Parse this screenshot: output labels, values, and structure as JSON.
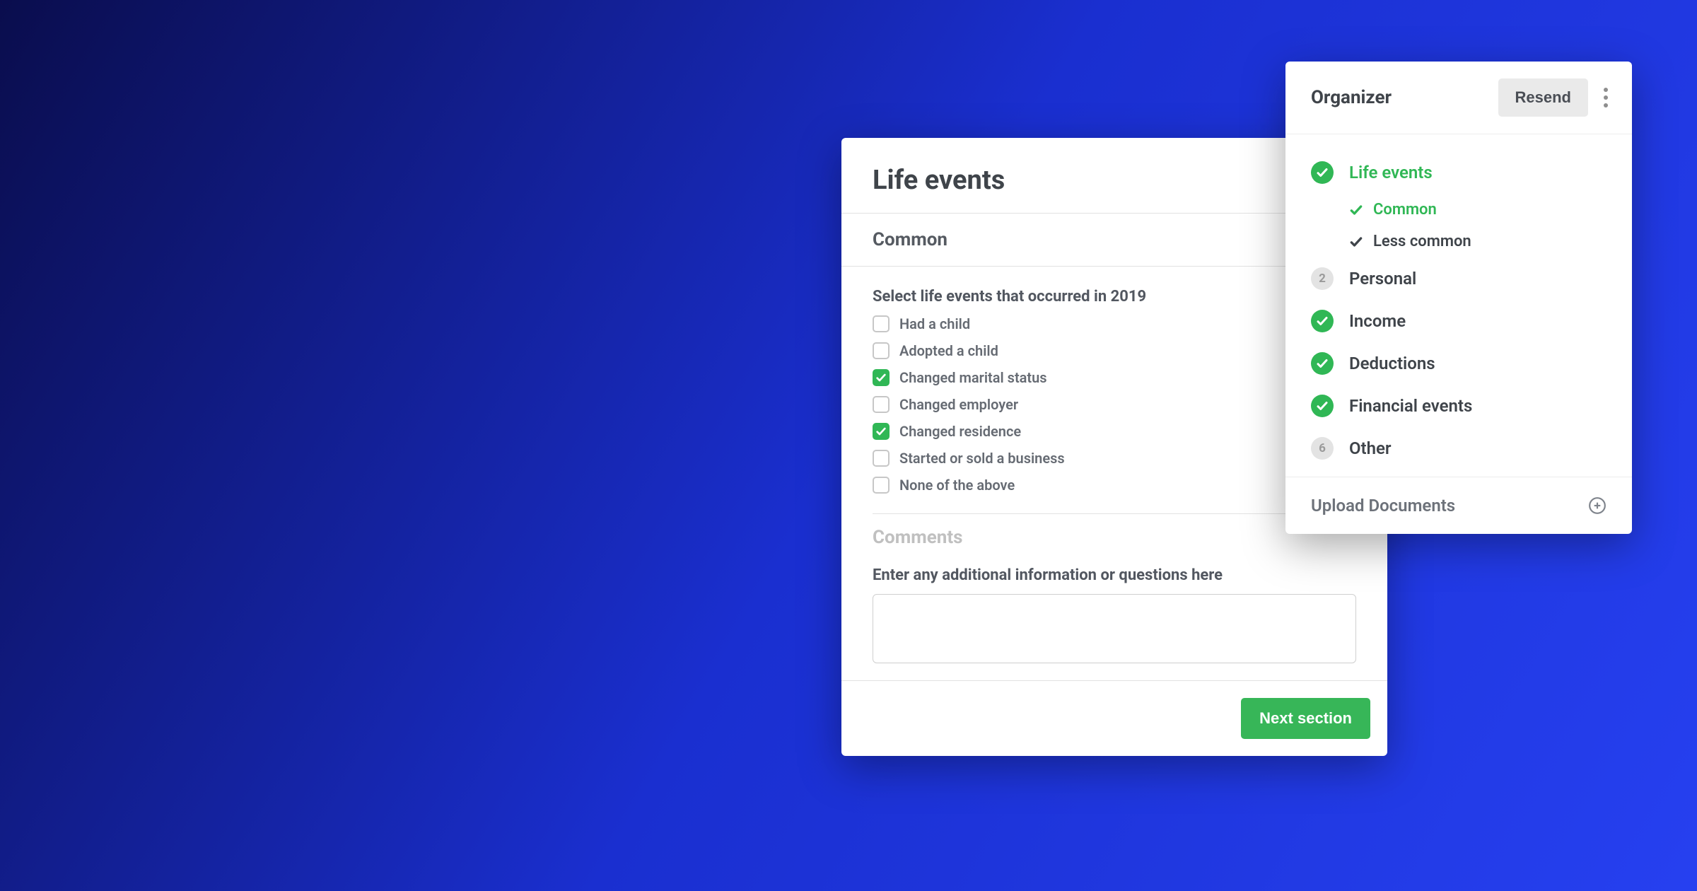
{
  "form": {
    "title": "Life events",
    "section_label": "Common",
    "prompt": "Select life events that occurred in 2019",
    "options": [
      {
        "label": "Had a child",
        "checked": false
      },
      {
        "label": "Adopted a child",
        "checked": false
      },
      {
        "label": "Changed marital status",
        "checked": true
      },
      {
        "label": "Changed employer",
        "checked": false
      },
      {
        "label": "Changed residence",
        "checked": true
      },
      {
        "label": "Started or sold a business",
        "checked": false
      },
      {
        "label": "None of the above",
        "checked": false
      }
    ],
    "comments_title": "Comments",
    "comments_label": "Enter any additional information or questions here",
    "next_button": "Next section"
  },
  "organizer": {
    "title": "Organizer",
    "resend_label": "Resend",
    "sections": [
      {
        "label": "Life events",
        "status": "done",
        "active": true,
        "subitems": [
          {
            "label": "Common",
            "active": true
          },
          {
            "label": "Less common",
            "active": false
          }
        ]
      },
      {
        "label": "Personal",
        "status": "pending",
        "number": "2"
      },
      {
        "label": "Income",
        "status": "done"
      },
      {
        "label": "Deductions",
        "status": "done"
      },
      {
        "label": "Financial events",
        "status": "done"
      },
      {
        "label": "Other",
        "status": "pending",
        "number": "6"
      }
    ],
    "upload_label": "Upload Documents"
  }
}
